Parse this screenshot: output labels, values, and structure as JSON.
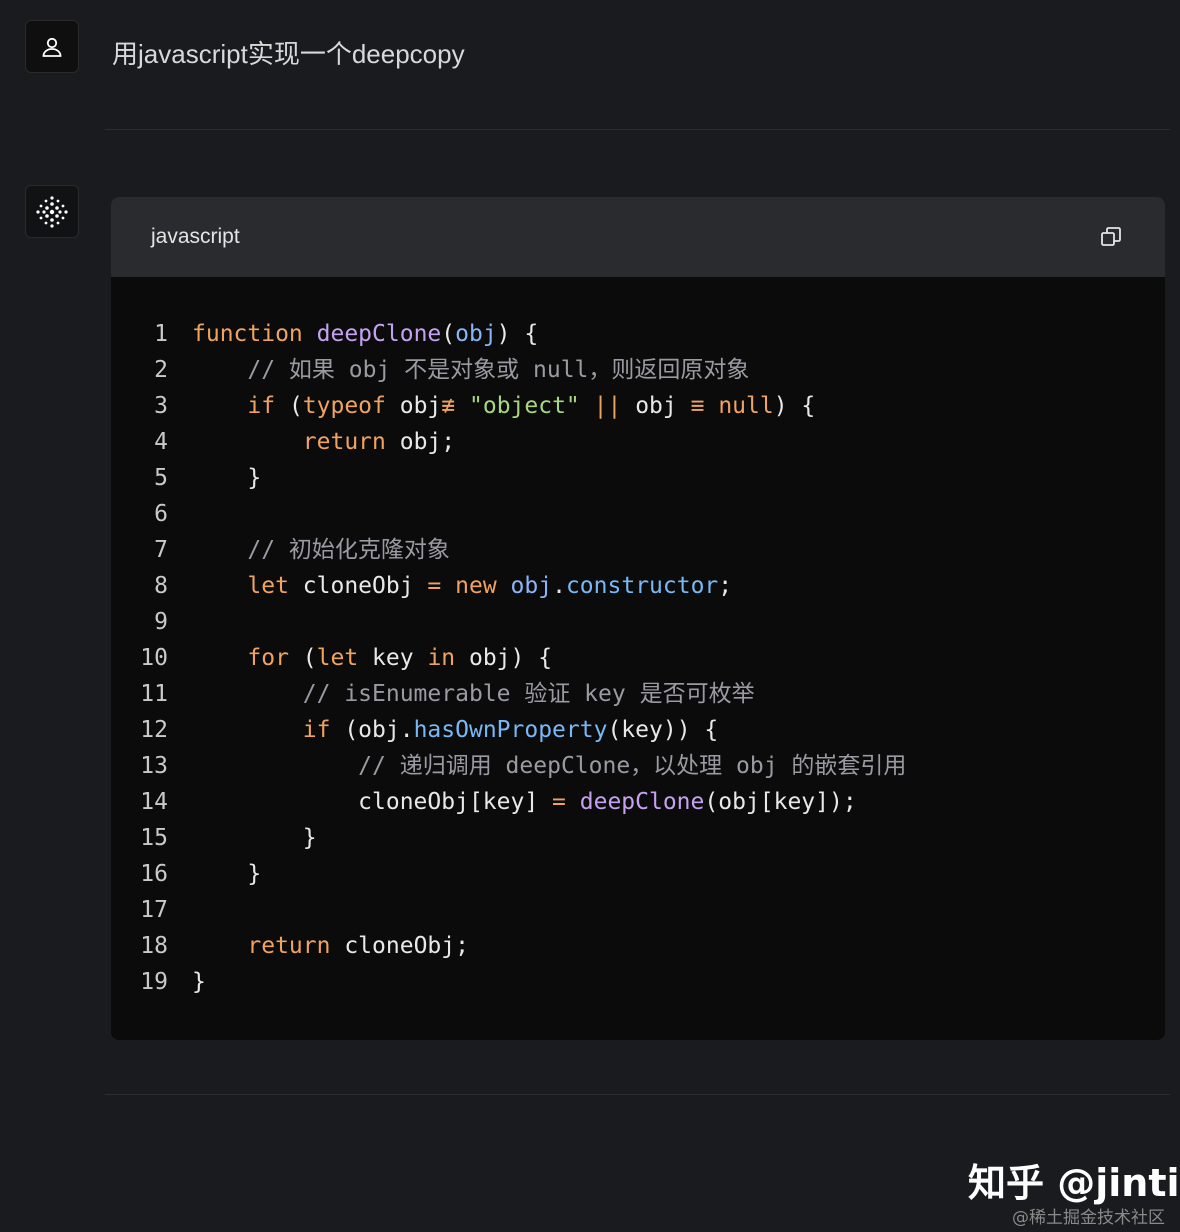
{
  "user_message": "用javascript实现一个deepcopy",
  "code_block": {
    "language": "javascript",
    "lines": [
      [
        {
          "t": "function",
          "c": "kw"
        },
        {
          "t": " "
        },
        {
          "t": "deepClone",
          "c": "fn"
        },
        {
          "t": "("
        },
        {
          "t": "obj",
          "c": "par"
        },
        {
          "t": ") {"
        }
      ],
      [
        {
          "t": "    "
        },
        {
          "t": "// 如果 obj 不是对象或 null，则返回原对象",
          "c": "cm"
        }
      ],
      [
        {
          "t": "    "
        },
        {
          "t": "if",
          "c": "kw"
        },
        {
          "t": " ("
        },
        {
          "t": "typeof",
          "c": "kw"
        },
        {
          "t": " obj"
        },
        {
          "t": "≢",
          "c": "op"
        },
        {
          "t": " "
        },
        {
          "t": "\"object\"",
          "c": "st"
        },
        {
          "t": " "
        },
        {
          "t": "||",
          "c": "op"
        },
        {
          "t": " obj "
        },
        {
          "t": "≡",
          "c": "op"
        },
        {
          "t": " "
        },
        {
          "t": "null",
          "c": "kw"
        },
        {
          "t": ") {"
        }
      ],
      [
        {
          "t": "        "
        },
        {
          "t": "return",
          "c": "kw"
        },
        {
          "t": " obj;"
        }
      ],
      [
        {
          "t": "    }"
        }
      ],
      [
        {
          "t": ""
        }
      ],
      [
        {
          "t": "    "
        },
        {
          "t": "// 初始化克隆对象",
          "c": "cm"
        }
      ],
      [
        {
          "t": "    "
        },
        {
          "t": "let",
          "c": "kw"
        },
        {
          "t": " cloneObj "
        },
        {
          "t": "=",
          "c": "op"
        },
        {
          "t": " "
        },
        {
          "t": "new",
          "c": "kw"
        },
        {
          "t": " "
        },
        {
          "t": "obj",
          "c": "par"
        },
        {
          "t": "."
        },
        {
          "t": "constructor",
          "c": "pr"
        },
        {
          "t": ";"
        }
      ],
      [
        {
          "t": ""
        }
      ],
      [
        {
          "t": "    "
        },
        {
          "t": "for",
          "c": "kw"
        },
        {
          "t": " ("
        },
        {
          "t": "let",
          "c": "kw"
        },
        {
          "t": " key "
        },
        {
          "t": "in",
          "c": "kw"
        },
        {
          "t": " obj) {"
        }
      ],
      [
        {
          "t": "        "
        },
        {
          "t": "// isEnumerable 验证 key 是否可枚举",
          "c": "cm"
        }
      ],
      [
        {
          "t": "        "
        },
        {
          "t": "if",
          "c": "kw"
        },
        {
          "t": " (obj."
        },
        {
          "t": "hasOwnProperty",
          "c": "pr"
        },
        {
          "t": "(key)) {"
        }
      ],
      [
        {
          "t": "            "
        },
        {
          "t": "// 递归调用 deepClone，以处理 obj 的嵌套引用",
          "c": "cm"
        }
      ],
      [
        {
          "t": "            cloneObj[key] "
        },
        {
          "t": "=",
          "c": "op"
        },
        {
          "t": " "
        },
        {
          "t": "deepClone",
          "c": "fn"
        },
        {
          "t": "(obj[key]);"
        }
      ],
      [
        {
          "t": "        }"
        }
      ],
      [
        {
          "t": "    }"
        }
      ],
      [
        {
          "t": ""
        }
      ],
      [
        {
          "t": "    "
        },
        {
          "t": "return",
          "c": "kw"
        },
        {
          "t": " cloneObj;"
        }
      ],
      [
        {
          "t": "}"
        }
      ]
    ]
  },
  "watermark": {
    "main": "知乎 @jinti",
    "sub": "@稀土掘金技术社区"
  },
  "icons": {
    "user": "user-icon",
    "assistant": "assistant-dots-icon",
    "copy": "copy-icon"
  },
  "colors": {
    "background": "#1a1b1e",
    "code_background": "#0b0b0c",
    "header_background": "#2a2b2f",
    "keyword": "#f0a35e",
    "function": "#c4a2f0",
    "string": "#a7d880",
    "comment": "#9a9aa2",
    "property": "#79b8f5"
  }
}
